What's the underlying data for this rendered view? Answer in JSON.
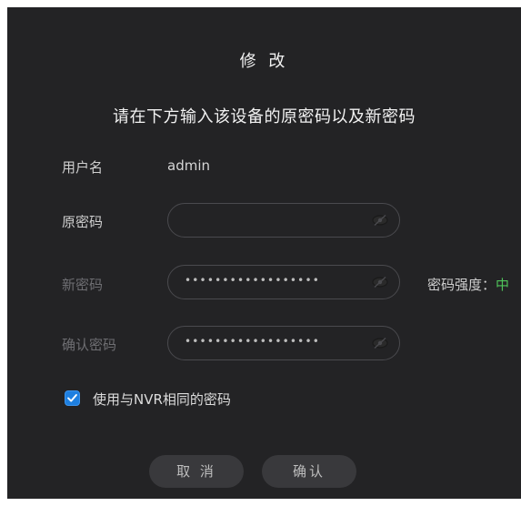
{
  "dialog": {
    "title": "修 改",
    "subtitle": "请在下方输入该设备的原密码以及新密码"
  },
  "form": {
    "username_label": "用户名",
    "username_value": "admin",
    "old_password_label": "原密码",
    "old_password_value": "",
    "new_password_label": "新密码",
    "new_password_value": "••••••••••••••••••",
    "confirm_password_label": "确认密码",
    "confirm_password_value": "••••••••••••••••••",
    "strength_label": "密码强度：",
    "strength_value": "中",
    "strength_color": "#4fc35a",
    "eye_icon": "eye-hidden-icon"
  },
  "options": {
    "same_as_nvr_label": "使用与NVR相同的密码",
    "same_as_nvr_checked": true
  },
  "buttons": {
    "cancel_label": "取 消",
    "confirm_label": "确认"
  },
  "colors": {
    "background": "#232325",
    "accent": "#1e7fe0"
  }
}
